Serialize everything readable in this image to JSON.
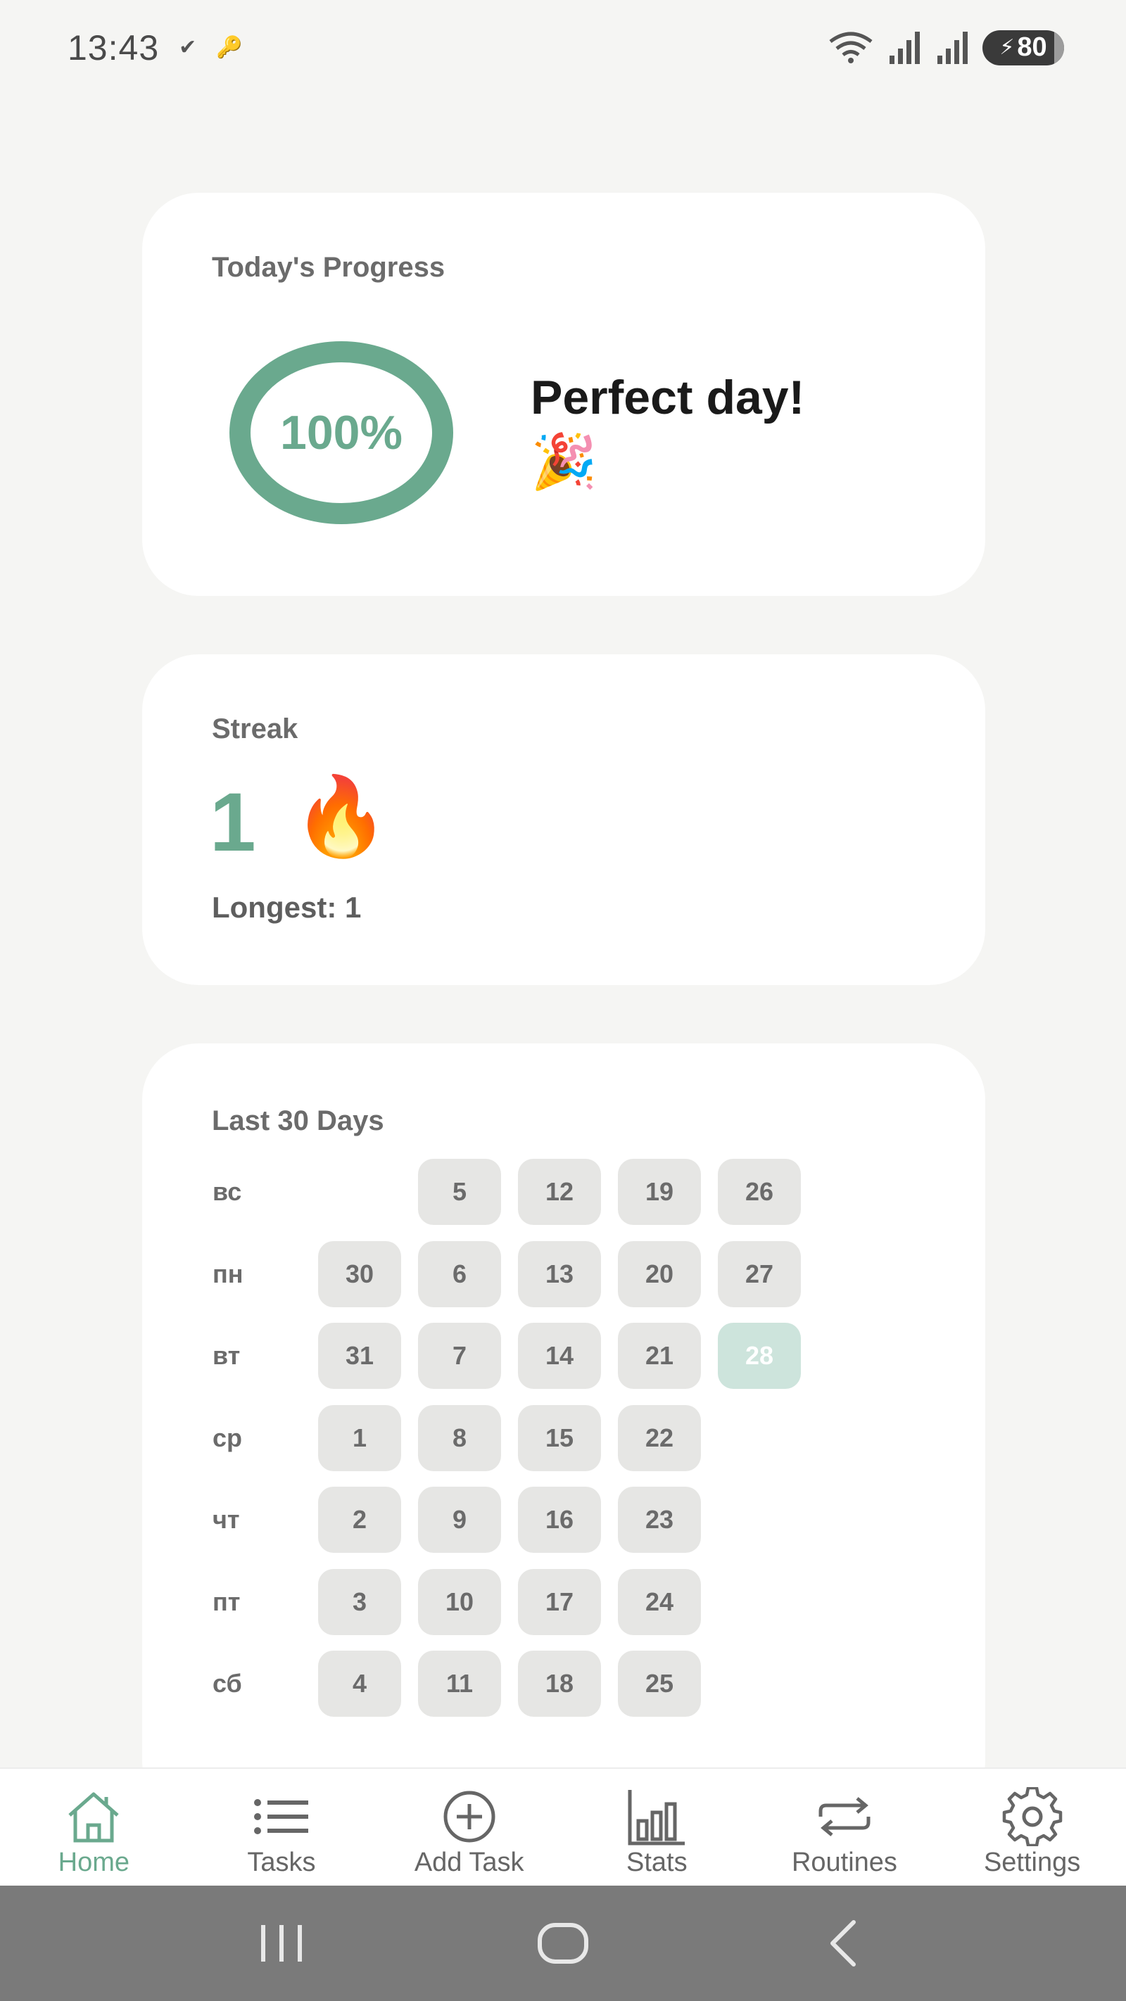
{
  "status_bar": {
    "time": "13:43",
    "check_glyph": "✔",
    "key_glyph": "🔑",
    "battery": "80",
    "icons": [
      "wifi-icon",
      "signal-icon",
      "signal-icon",
      "battery-charging-icon"
    ]
  },
  "progress_card": {
    "title": "Today's Progress",
    "percent_label": "100%",
    "percent_value": 100,
    "message": "Perfect day!",
    "party_emoji": "🎉"
  },
  "streak_card": {
    "title": "Streak",
    "count": "1",
    "fire_emoji": "🔥",
    "longest": "Longest: 1"
  },
  "days_card": {
    "title": "Last 30 Days",
    "weekdays": [
      "вс",
      "пн",
      "вт",
      "ср",
      "чт",
      "пт",
      "сб"
    ],
    "columns": [
      [
        "",
        "30",
        "31",
        "1",
        "2",
        "3",
        "4"
      ],
      [
        "5",
        "6",
        "7",
        "8",
        "9",
        "10",
        "11"
      ],
      [
        "12",
        "13",
        "14",
        "15",
        "16",
        "17",
        "18"
      ],
      [
        "19",
        "20",
        "21",
        "22",
        "23",
        "24",
        "25"
      ],
      [
        "26",
        "27",
        "28",
        "",
        "",
        "",
        ""
      ]
    ],
    "completed_days": [
      "28"
    ]
  },
  "bottom_nav": [
    {
      "label": "Home",
      "icon": "home-icon",
      "active": true
    },
    {
      "label": "Tasks",
      "icon": "list-icon",
      "active": false
    },
    {
      "label": "Add Task",
      "icon": "add-circle-icon",
      "active": false
    },
    {
      "label": "Stats",
      "icon": "bar-chart-icon",
      "active": false
    },
    {
      "label": "Routines",
      "icon": "repeat-icon",
      "active": false
    },
    {
      "label": "Settings",
      "icon": "gear-icon",
      "active": false
    }
  ],
  "colors": {
    "accent": "#6aa98e",
    "background": "#f5f5f3",
    "card": "#ffffff",
    "cell": "#e6e6e4",
    "cell_done": "#cde4dc"
  }
}
